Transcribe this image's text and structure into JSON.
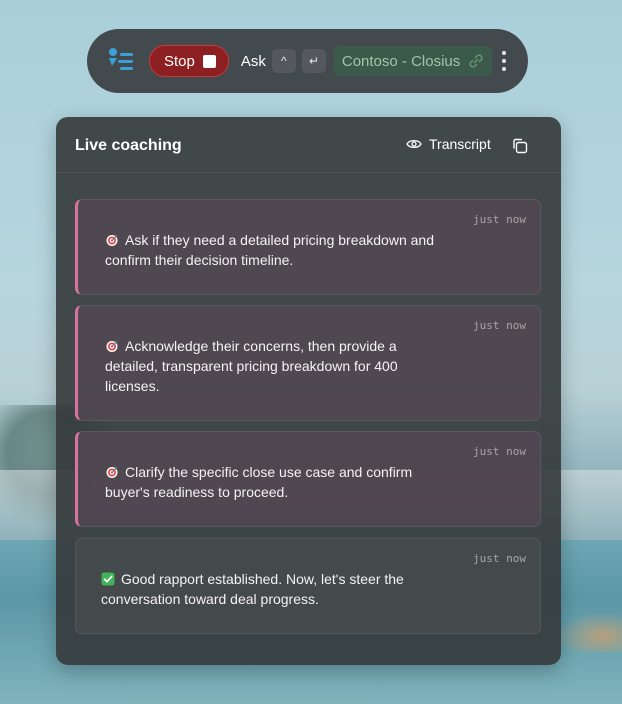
{
  "toolbar": {
    "stop_label": "Stop",
    "ask_label": "Ask",
    "key_up": "^",
    "key_enter": "↵",
    "contact_name": "Contoso - Closius"
  },
  "panel": {
    "title": "Live coaching",
    "transcript_label": "Transcript"
  },
  "cards": [
    {
      "time": "just now",
      "icon": "target-icon",
      "text": "Ask if they need a detailed pricing breakdown and confirm their decision timeline."
    },
    {
      "time": "just now",
      "icon": "target-icon",
      "text": "Acknowledge their concerns, then provide a detailed, transparent pricing breakdown for 400 licenses."
    },
    {
      "time": "just now",
      "icon": "target-icon",
      "text": "Clarify the specific close use case and confirm buyer's readiness to proceed."
    },
    {
      "time": "just now",
      "icon": "check-icon",
      "text": "Good rapport established. Now, let's steer the conversation toward deal progress."
    }
  ],
  "colors": {
    "stop_bg": "#8c1f22",
    "accent_pink": "#d6749e",
    "contact_green": "#9fc6ad",
    "logo_blue": "#3aa0d8"
  }
}
